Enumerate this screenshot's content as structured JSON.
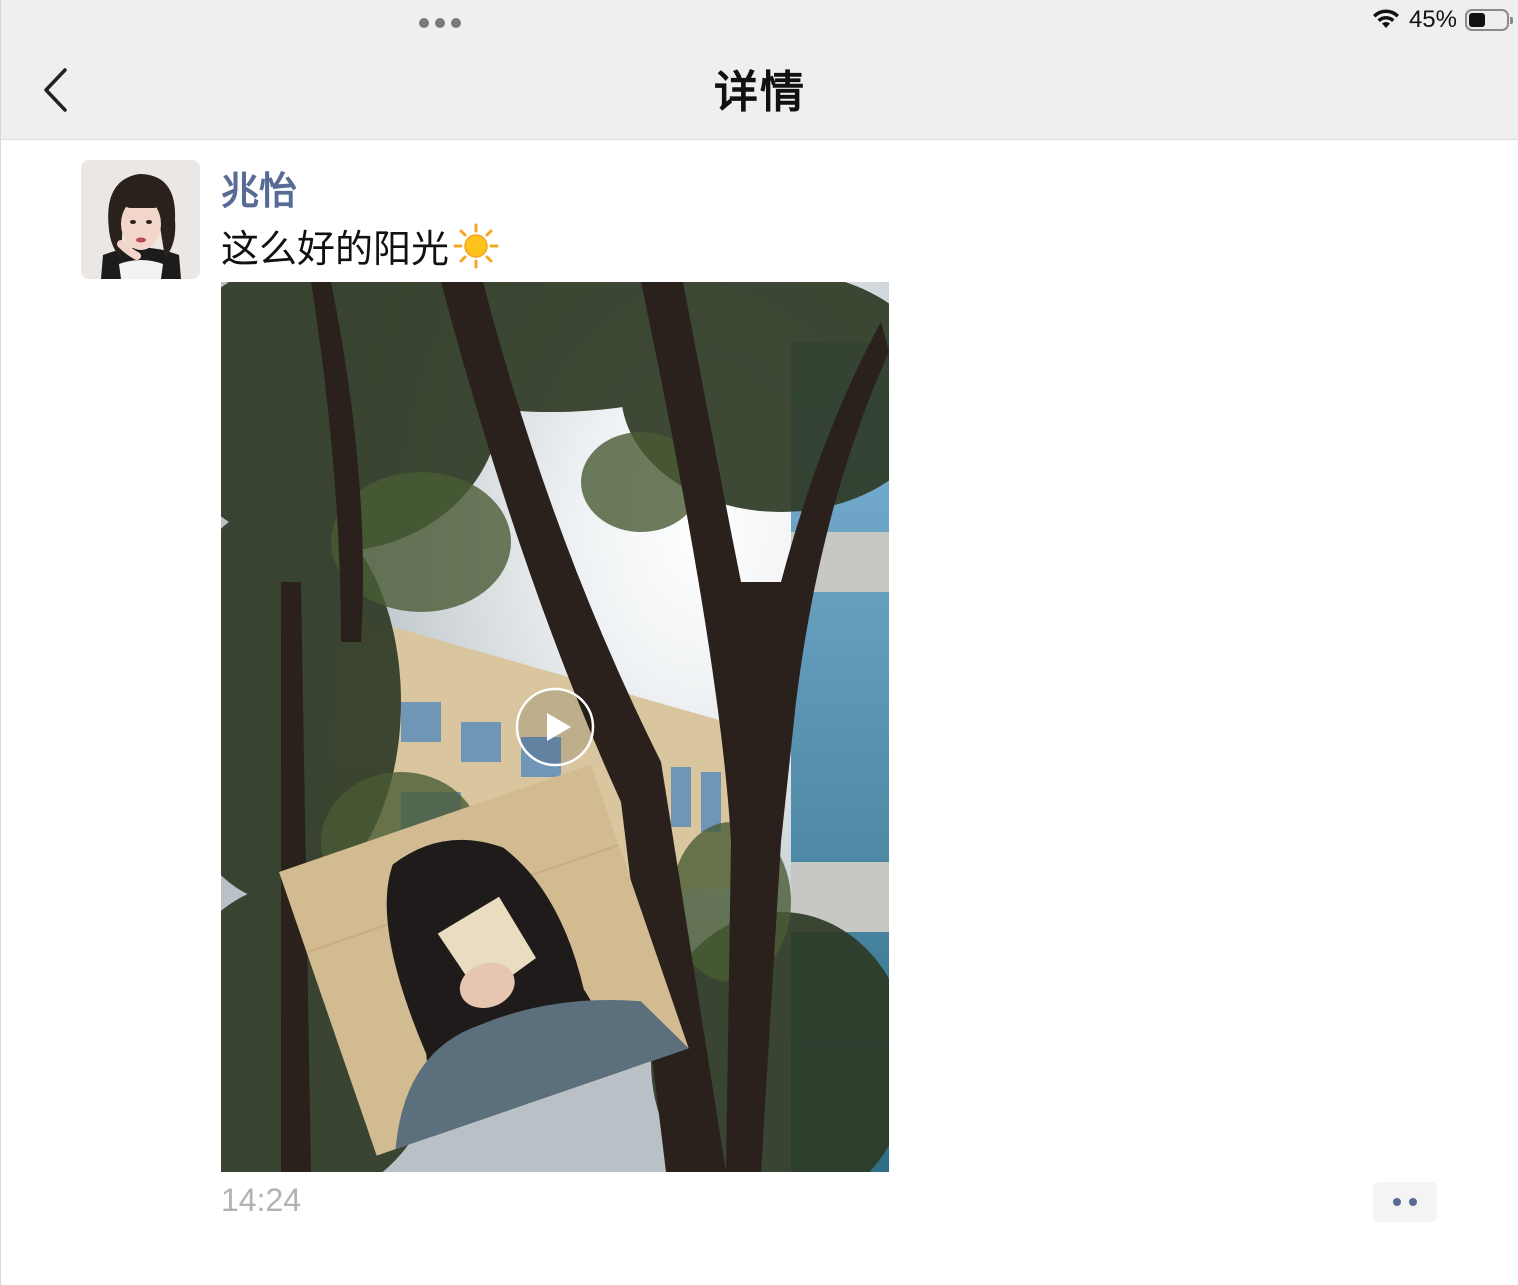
{
  "status_bar": {
    "battery_percent": "45%",
    "battery_level": 0.45,
    "icons": [
      "multitask-dots-icon",
      "wifi-icon",
      "battery-icon"
    ]
  },
  "nav": {
    "back_icon": "chevron-left-icon",
    "title": "详情"
  },
  "post": {
    "author": "兆怡",
    "text": "这么好的阳光",
    "emoji_icon": "sun-icon",
    "media_type": "video",
    "play_icon": "play-icon",
    "time": "14:24",
    "more_icon": "two-dots-icon"
  },
  "colors": {
    "link_blue": "#576b95",
    "nav_bg": "#efefef",
    "time_gray": "#b2b2b2"
  }
}
